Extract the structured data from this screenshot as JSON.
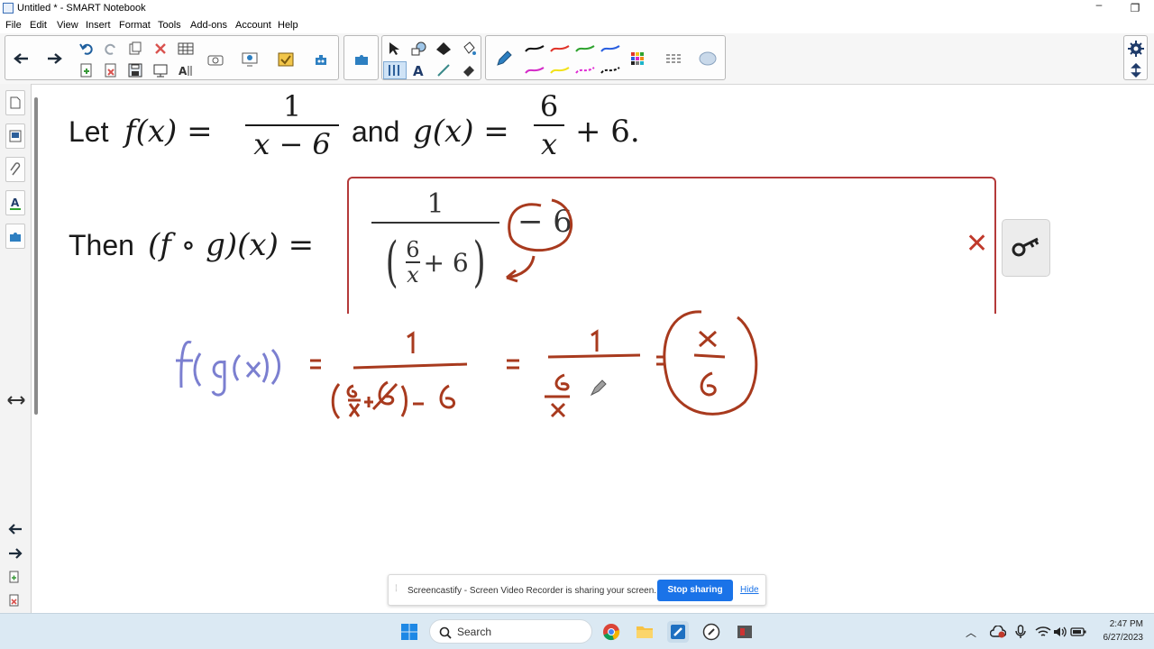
{
  "window": {
    "title": "Untitled * - SMART Notebook",
    "minimize": "–",
    "maximize": "❐",
    "close": "✕"
  },
  "menu": [
    "File",
    "Edit",
    "View",
    "Insert",
    "Format",
    "Tools",
    "Add-ons",
    "Account",
    "Help"
  ],
  "problem": {
    "let_word": "Let",
    "f_def": "f(x) =",
    "f_num": "1",
    "f_den": "x − 6",
    "and_word": "and",
    "g_def": "g(x) =",
    "g_num": "6",
    "g_den": "x",
    "g_tail": "+ 6.",
    "then_word": "Then",
    "comp_def": "(f ∘ g)(x) =",
    "ans_num": "1",
    "ans_inner_num": "6",
    "ans_inner_den": "x",
    "ans_inner_plus": "+ 6",
    "ans_tail": "− 6",
    "incorrect_mark": "✕"
  },
  "handwriting": {
    "lhs": "f(g(x))",
    "eq1": "=",
    "step1_num": "1",
    "step1_den": "(6/x + 6) − 6",
    "eq2": "=",
    "step2_num": "1",
    "step2_den_num": "6",
    "step2_den_den": "x",
    "eq3": "=",
    "result_num": "x",
    "result_den": "6",
    "blue_color": "#7b7fd0",
    "red_color": "#a83a1e"
  },
  "share_banner": {
    "message": "Screencastify - Screen Video Recorder is sharing your screen.",
    "stop_label": "Stop sharing",
    "hide_label": "Hide"
  },
  "taskbar": {
    "search_label": "Search",
    "time": "2:47 PM",
    "date": "6/27/2023"
  },
  "colors": {
    "answer_border": "#b43a3a",
    "incorrect_x": "#c0392b",
    "accent_blue": "#1a73e8"
  }
}
